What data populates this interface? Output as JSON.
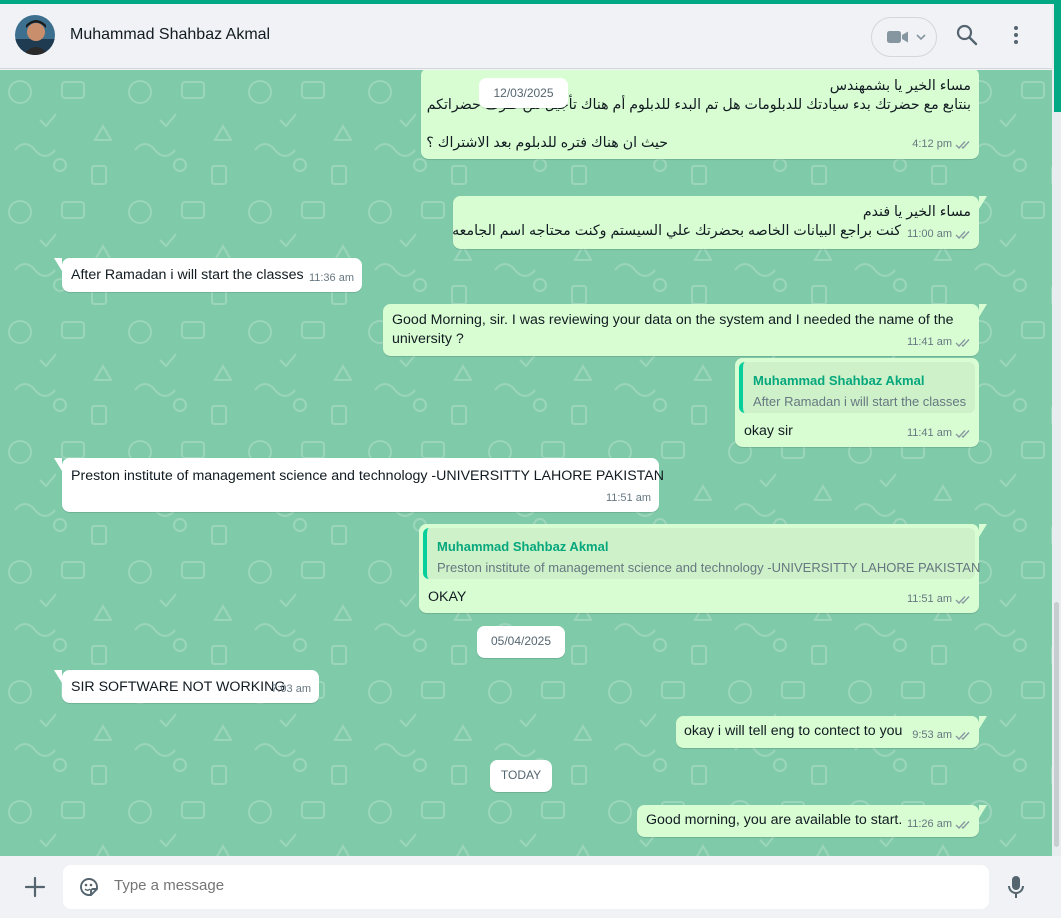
{
  "header": {
    "contact_name": "Muhammad Shahbaz Akmal",
    "icons": [
      "avatar",
      "video-call-icon",
      "chevron-down-icon",
      "search-icon",
      "menu-icon"
    ]
  },
  "colors": {
    "accent": "#00a884",
    "chat_bg": "#7fcaa9",
    "outgoing_bubble": "#d9fdd3",
    "incoming_bubble": "#ffffff",
    "quote_author": "#06a77d"
  },
  "dates": {
    "d1": "12/03/2025",
    "d2": "05/04/2025",
    "d3": "TODAY"
  },
  "messages": {
    "m1": {
      "direction": "outgoing",
      "line1": "مساء الخير يا بشمهندس",
      "line2": "بنتابع مع حضرتك بدء سيادتك للدبلومات هل تم البدء للدبلوم أم هناك تأجيل من طرف حضراتكم",
      "line3": "حيث ان هناك فتره للدبلوم بعد الاشتراك ؟",
      "time": "4:12 pm"
    },
    "m2": {
      "direction": "outgoing",
      "line1": "مساء الخير يا فندم",
      "line2": "كنت براجع البيانات الخاصه بحضرتك علي السيستم وكنت محتاجه اسم الجامعه",
      "time": "11:00 am"
    },
    "m3": {
      "direction": "incoming",
      "text": "After Ramadan  i will start the classes",
      "time": "11:36 am"
    },
    "m4": {
      "direction": "outgoing",
      "line1": "Good Morning, sir. I was reviewing your data on the system and I needed the name of the",
      "line2": "university ?",
      "time": "11:41 am"
    },
    "m5": {
      "direction": "outgoing",
      "quote_author": "Muhammad Shahbaz Akmal",
      "quote_text": "After Ramadan  i will start the classes",
      "text": "okay sir",
      "time": "11:41 am"
    },
    "m6": {
      "direction": "incoming",
      "text": "Preston institute of management science and technology -UNIVERSITTY LAHORE PAKISTAN",
      "time": "11:51 am"
    },
    "m7": {
      "direction": "outgoing",
      "quote_author": "Muhammad Shahbaz Akmal",
      "quote_text": "Preston institute of management science and technology -UNIVERSITTY LAHORE PAKISTAN",
      "text": "OKAY",
      "time": "11:51 am"
    },
    "m8": {
      "direction": "incoming",
      "text": "SIR SOFTWARE NOT WORKING",
      "time": "7:03 am"
    },
    "m9": {
      "direction": "outgoing",
      "text": "okay i will tell eng to contect to you",
      "time": "9:53 am"
    },
    "m10": {
      "direction": "outgoing",
      "text": "Good morning, you are available to start.",
      "time": "11:26 am"
    }
  },
  "composer": {
    "placeholder": "Type a message",
    "icons": [
      "plus-icon",
      "sticker-icon",
      "mic-icon"
    ]
  }
}
